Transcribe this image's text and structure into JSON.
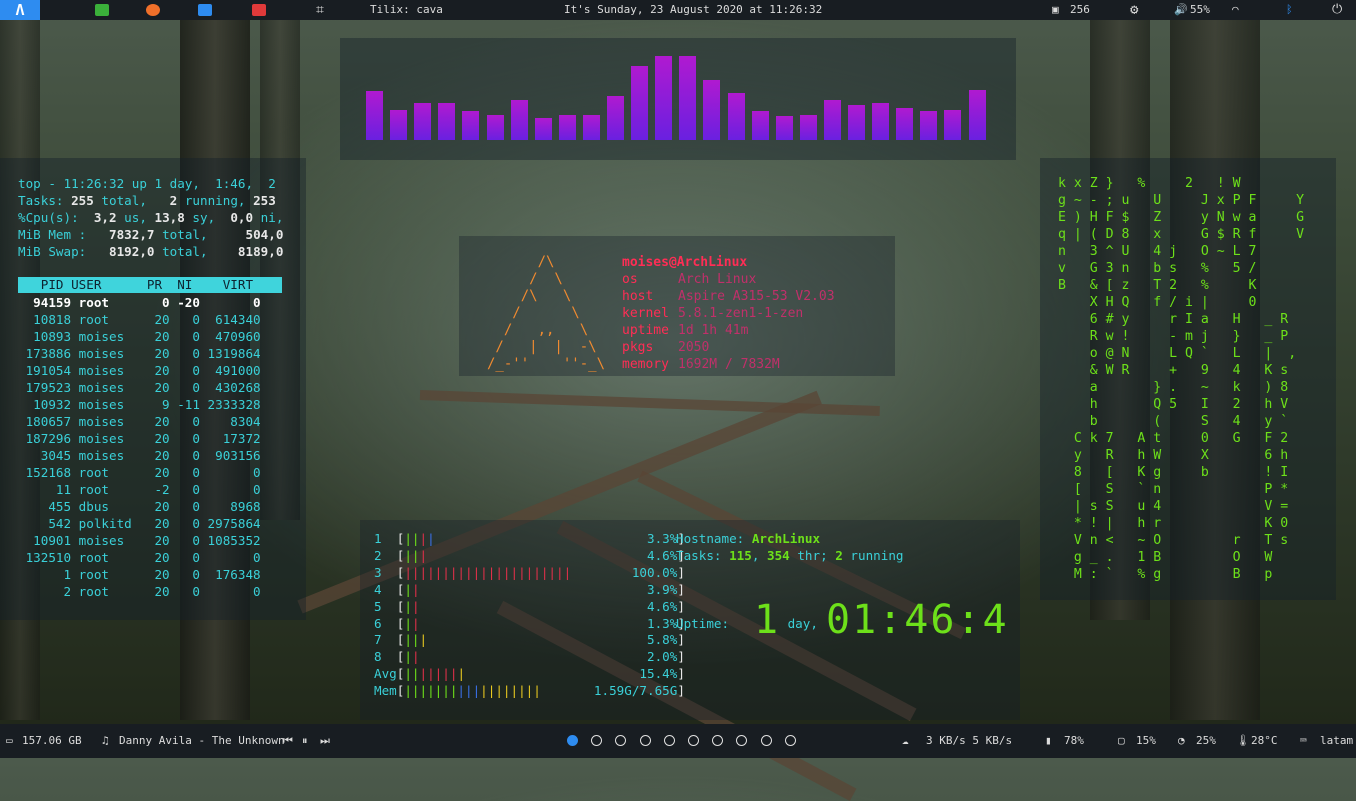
{
  "topbar": {
    "window_title": "Tilix: cava",
    "datetime": "It's Sunday, 23 August 2020 at 11:26:32",
    "packages": "256",
    "volume": "55%",
    "icons": [
      "arch-launcher-icon",
      "terminal-icon",
      "firefox-icon",
      "folder-icon",
      "settings-app-icon",
      "crop-icon",
      "package-icon",
      "settings-icon",
      "volume-icon",
      "wifi-icon",
      "bluetooth-icon",
      "power-icon"
    ],
    "colors": {
      "launcher": "#2e8cf0",
      "terminal": "#3ab03a",
      "firefox": "#f0702a",
      "folder": "#2e8cf0",
      "settings_app": "#e03a3a"
    }
  },
  "cava": {
    "levels": [
      0.58,
      0.36,
      0.44,
      0.44,
      0.34,
      0.3,
      0.48,
      0.26,
      0.3,
      0.3,
      0.52,
      0.88,
      1.0,
      1.0,
      0.72,
      0.56,
      0.34,
      0.28,
      0.3,
      0.48,
      0.42,
      0.44,
      0.38,
      0.34,
      0.36,
      0.6
    ],
    "gradient": [
      "#b01ad0",
      "#6a20e0"
    ]
  },
  "top": {
    "summary": [
      {
        "t": "top - 11:26:32 up 1 day,  1:46,  2"
      },
      {
        "a": "Tasks: ",
        "b": "255",
        "c": " total,   ",
        "d": "2",
        "e": " running, ",
        "f": "253"
      },
      {
        "a": "%Cpu(s):  ",
        "b": "3,2",
        "c": " us, ",
        "d": "13,8",
        "e": " sy,  ",
        "f": "0,0",
        "g": " ni,"
      },
      {
        "a": "MiB Mem :   ",
        "b": "7832,7",
        "c": " total,     ",
        "d": "504,0"
      },
      {
        "a": "MiB Swap:   ",
        "b": "8192,0",
        "c": " total,    ",
        "d": "8189,0"
      }
    ],
    "header": "   PID USER      PR  NI    VIRT",
    "rows": [
      "  94159 root       0 -20       0",
      "  10818 root      20   0  614340",
      "  10893 moises    20   0  470960",
      " 173886 moises    20   0 1319864",
      " 191054 moises    20   0  491000",
      " 179523 moises    20   0  430268",
      "  10932 moises     9 -11 2333328",
      " 180657 moises    20   0    8304",
      " 187296 moises    20   0   17372",
      "   3045 moises    20   0  903156",
      " 152168 root      20   0       0",
      "     11 root      -2   0       0",
      "    455 dbus      20   0    8968",
      "    542 polkitd   20   0 2975864",
      "  10901 moises    20   0 1085352",
      " 132510 root      20   0       0",
      "      1 root      20   0  176348",
      "      2 root      20   0       0"
    ]
  },
  "neofetch": {
    "logo": [
      "      /\\",
      "     /  \\",
      "    /\\   \\",
      "   /      \\",
      "  /   ,,   \\",
      " /   |  |  -\\",
      "/_-''    ''-_\\"
    ],
    "user": "moises@ArchLinux",
    "fields": [
      {
        "k": "os",
        "v": "Arch Linux"
      },
      {
        "k": "host",
        "v": "Aspire A315-53 V2.03"
      },
      {
        "k": "kernel",
        "v": "5.8.1-zen1-1-zen"
      },
      {
        "k": "uptime",
        "v": "1d 1h 41m"
      },
      {
        "k": "pkgs",
        "v": "2050"
      },
      {
        "k": "memory",
        "v": "1692M / 7832M"
      }
    ]
  },
  "matrix": [
    "k x Z }   %     2   ! W",
    "g ~ - ; u   U     J x P F     Y",
    "E ) H F $   Z     y N w a     G",
    "q | ( D 8   x     G $ R f     V",
    "n   3 ^ U   4 j   O ~ L 7",
    "v   G 3 n   b s   %   5 /",
    "B   & [ z   T 2   %     K",
    "    X H Q   f / i |     0",
    "    6 # y     r I a   H   _ R",
    "    R w !     - m j   }   _ P",
    "    o @ N     L Q `   L   |  ,",
    "    & W R     +   9   4   K s",
    "    a       } .   ~   k   ) 8",
    "    h       Q 5   I   2   h V",
    "    b       (     S   4   y `",
    "  C k 7   A t     0   G   F 2",
    "  y   R   h W     X       6 h",
    "  8   [   K g     b       ! I",
    "  [   S   ` n             P *",
    "  | s S   u 4             V =",
    "  * ! |   h r             K 0",
    "  V n <   ~ O         r   T s",
    "  g _ .   1 B         O   W",
    "  M : `   % g         B   p"
  ],
  "htop": {
    "cpus": [
      {
        "label": "1",
        "bars": [
          {
            "c": "g",
            "t": "||"
          },
          {
            "c": "r",
            "t": "|"
          },
          {
            "c": "b",
            "t": "|"
          }
        ],
        "pct": "3.3%"
      },
      {
        "label": "2",
        "bars": [
          {
            "c": "g",
            "t": "||"
          },
          {
            "c": "r",
            "t": "|"
          }
        ],
        "pct": "4.6%"
      },
      {
        "label": "3",
        "bars": [
          {
            "c": "r",
            "t": "||||||||||||||||||||||"
          }
        ],
        "pct": "100.0%"
      },
      {
        "label": "4",
        "bars": [
          {
            "c": "g",
            "t": "|"
          },
          {
            "c": "r",
            "t": "|"
          }
        ],
        "pct": "3.9%"
      },
      {
        "label": "5",
        "bars": [
          {
            "c": "g",
            "t": "|"
          },
          {
            "c": "r",
            "t": "|"
          }
        ],
        "pct": "4.6%"
      },
      {
        "label": "6",
        "bars": [
          {
            "c": "g",
            "t": "|"
          },
          {
            "c": "r",
            "t": "|"
          }
        ],
        "pct": "1.3%"
      },
      {
        "label": "7",
        "bars": [
          {
            "c": "g",
            "t": "||"
          },
          {
            "c": "y",
            "t": "|"
          }
        ],
        "pct": "5.8%"
      },
      {
        "label": "8",
        "bars": [
          {
            "c": "g",
            "t": "|"
          },
          {
            "c": "r",
            "t": "|"
          }
        ],
        "pct": "2.0%"
      }
    ],
    "avg": {
      "label": "Avg",
      "bars": [
        {
          "c": "g",
          "t": "||"
        },
        {
          "c": "r",
          "t": "|||||"
        },
        {
          "c": "y",
          "t": "|"
        }
      ],
      "pct": "15.4%"
    },
    "mem": {
      "label": "Mem",
      "bars": [
        {
          "c": "g",
          "t": "|||||||"
        },
        {
          "c": "b",
          "t": "|||"
        },
        {
          "c": "y",
          "t": "||||||||"
        }
      ],
      "value": "1.59G/7.65G"
    },
    "hostname_label": "Hostname: ",
    "hostname": "ArchLinux",
    "tasks_label": "Tasks: ",
    "tasks": "115",
    "thr": "354",
    "thr_label": " thr; ",
    "running": "2",
    "running_label": " running",
    "uptime_label": "Uptime: ",
    "uptime_days": "1",
    "uptime_day_label": " day, ",
    "uptime_clock": "01:46:4"
  },
  "bottombar": {
    "disk": "157.06 GB",
    "music": "Danny Avila - The Unknown",
    "workspaces": 10,
    "active_workspace": 0,
    "network": "3 KB/s 5 KB/s",
    "battery": "78%",
    "memory": "15%",
    "cpu": "25%",
    "temp": "28°C",
    "keyboard": "latam"
  }
}
